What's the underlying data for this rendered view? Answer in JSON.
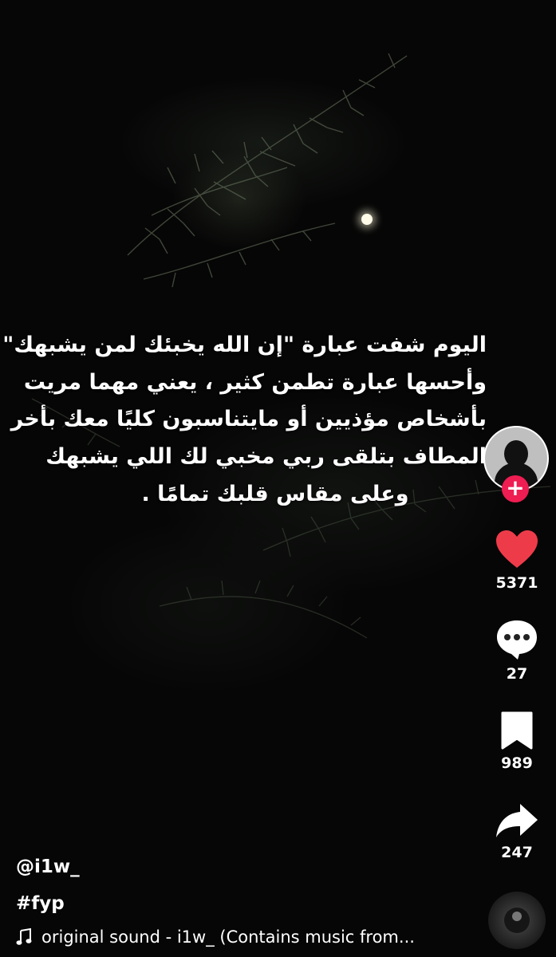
{
  "video": {
    "caption_lines": [
      "اليوم شفت عبارة \"إن الله يخبئك لمن يشبهك\"",
      "وأحسها عبارة تطمن كثير ، يعني مهما مريت",
      "بأشخاص مؤذيين أو مايتناسبون كليًا معك بأخر",
      "المطاف بتلقى ربي مخبي لك اللي يشبهك",
      "وعلى مقاس قلبك تمامًا ."
    ]
  },
  "rail": {
    "follow_symbol": "+",
    "likes": "5371",
    "comments": "27",
    "bookmarks": "989",
    "shares": "247"
  },
  "info": {
    "username": "@i1w_",
    "hashtag": "#fyp",
    "sound": "original sound - i1w_ (Contains music from..."
  },
  "colors": {
    "like_red": "#ee3b4a",
    "follow_red": "#ee1d52",
    "text": "#ffffff"
  },
  "icons": [
    "avatar-icon",
    "heart-icon",
    "comment-icon",
    "bookmark-icon",
    "share-icon",
    "music-note-icon",
    "music-disc-icon"
  ]
}
